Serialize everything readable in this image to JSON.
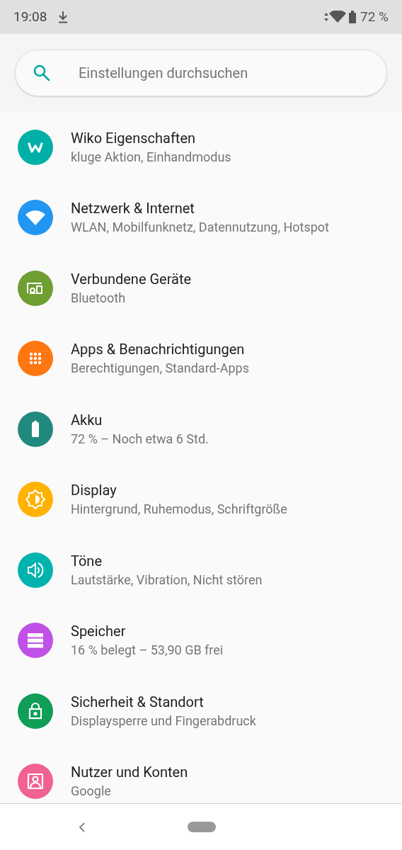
{
  "status_bar": {
    "time": "19:08",
    "battery": "72 %"
  },
  "search": {
    "placeholder": "Einstellungen durchsuchen"
  },
  "items": [
    {
      "kind": "wiko",
      "color": "#00b0a6",
      "title": "Wiko Eigenschaften",
      "subtitle": "kluge Aktion, Einhandmodus"
    },
    {
      "kind": "wifi",
      "color": "#2196f3",
      "title": "Netzwerk & Internet",
      "subtitle": "WLAN, Mobilfunknetz, Datennutzung, Hotspot"
    },
    {
      "kind": "devices",
      "color": "#6f9e32",
      "title": "Verbundene Geräte",
      "subtitle": "Bluetooth"
    },
    {
      "kind": "apps",
      "color": "#ff7711",
      "title": "Apps & Benachrichtigungen",
      "subtitle": "Berechtigungen, Standard-Apps"
    },
    {
      "kind": "battery",
      "color": "#218a7f",
      "title": "Akku",
      "subtitle": "72 % – Noch etwa 6 Std."
    },
    {
      "kind": "display",
      "color": "#ffb300",
      "title": "Display",
      "subtitle": "Hintergrund, Ruhemodus, Schriftgröße"
    },
    {
      "kind": "sound",
      "color": "#00b3ae",
      "title": "Töne",
      "subtitle": "Lautstärke, Vibration, Nicht stören"
    },
    {
      "kind": "storage",
      "color": "#c051e6",
      "title": "Speicher",
      "subtitle": "16 % belegt – 53,90 GB frei"
    },
    {
      "kind": "lock",
      "color": "#0f9d58",
      "title": "Sicherheit & Standort",
      "subtitle": "Displaysperre und Fingerabdruck"
    },
    {
      "kind": "account",
      "color": "#f06292",
      "title": "Nutzer und Konten",
      "subtitle": "Google"
    }
  ]
}
